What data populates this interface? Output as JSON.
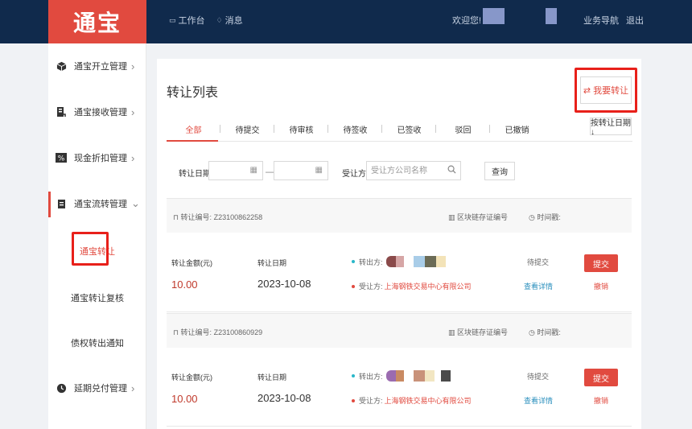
{
  "header": {
    "logo": "通宝",
    "nav": [
      {
        "label": "工作台",
        "icon": "desktop-icon"
      },
      {
        "label": "消息",
        "icon": "bell-icon"
      }
    ],
    "welcome": "欢迎您!",
    "guide": "业务导航",
    "logout": "退出"
  },
  "sidebar": {
    "items": [
      {
        "label": "通宝开立管理",
        "icon": "cube-icon",
        "arrow": "›"
      },
      {
        "label": "通宝接收管理",
        "icon": "receive-doc-icon",
        "arrow": "›"
      },
      {
        "label": "现金折扣管理",
        "icon": "percent-icon",
        "arrow": "›"
      },
      {
        "label": "通宝流转管理",
        "icon": "flow-doc-icon",
        "arrow": "⌄"
      },
      {
        "label": "延期兑付管理",
        "icon": "clock-icon",
        "arrow": "›"
      }
    ],
    "subitems": [
      "通宝转让",
      "通宝转让复核",
      "债权转出通知"
    ]
  },
  "main": {
    "title": "转让列表",
    "transfer_button": "我要转让",
    "transfer_icon": "⇄",
    "tabs": [
      "全部",
      "待提交",
      "待审核",
      "待签收",
      "已签收",
      "驳回",
      "已撤销"
    ],
    "sort_button": "按转让日期↓",
    "filter": {
      "date_label": "转让日期:",
      "receiver_label": "受让方:",
      "receiver_placeholder": "受让方公司名称",
      "query_button": "查询"
    },
    "columns": {
      "no_prefix": "转让编号:",
      "chain": "区块链存证编号",
      "timestamp": "时间戳:",
      "amount": "转让金额(元)",
      "date": "转让日期",
      "sender": "转出方:",
      "receiver": "受让方:"
    },
    "records": [
      {
        "no": "Z23100862258",
        "amount": "10.00",
        "date": "2023-10-08",
        "receiver": "上海钢铁交易中心有限公司",
        "status": "待提交",
        "detail": "查看详情",
        "submit": "提交",
        "cancel": "撤销"
      },
      {
        "no": "Z23100860929",
        "amount": "10.00",
        "date": "2023-10-08",
        "receiver": "上海钢铁交易中心有限公司",
        "status": "待提交",
        "detail": "查看详情",
        "submit": "提交",
        "cancel": "撤销"
      }
    ]
  },
  "colors": {
    "accent": "#e14a3f",
    "topbar": "#102a4c",
    "link": "#2a8fbd"
  }
}
